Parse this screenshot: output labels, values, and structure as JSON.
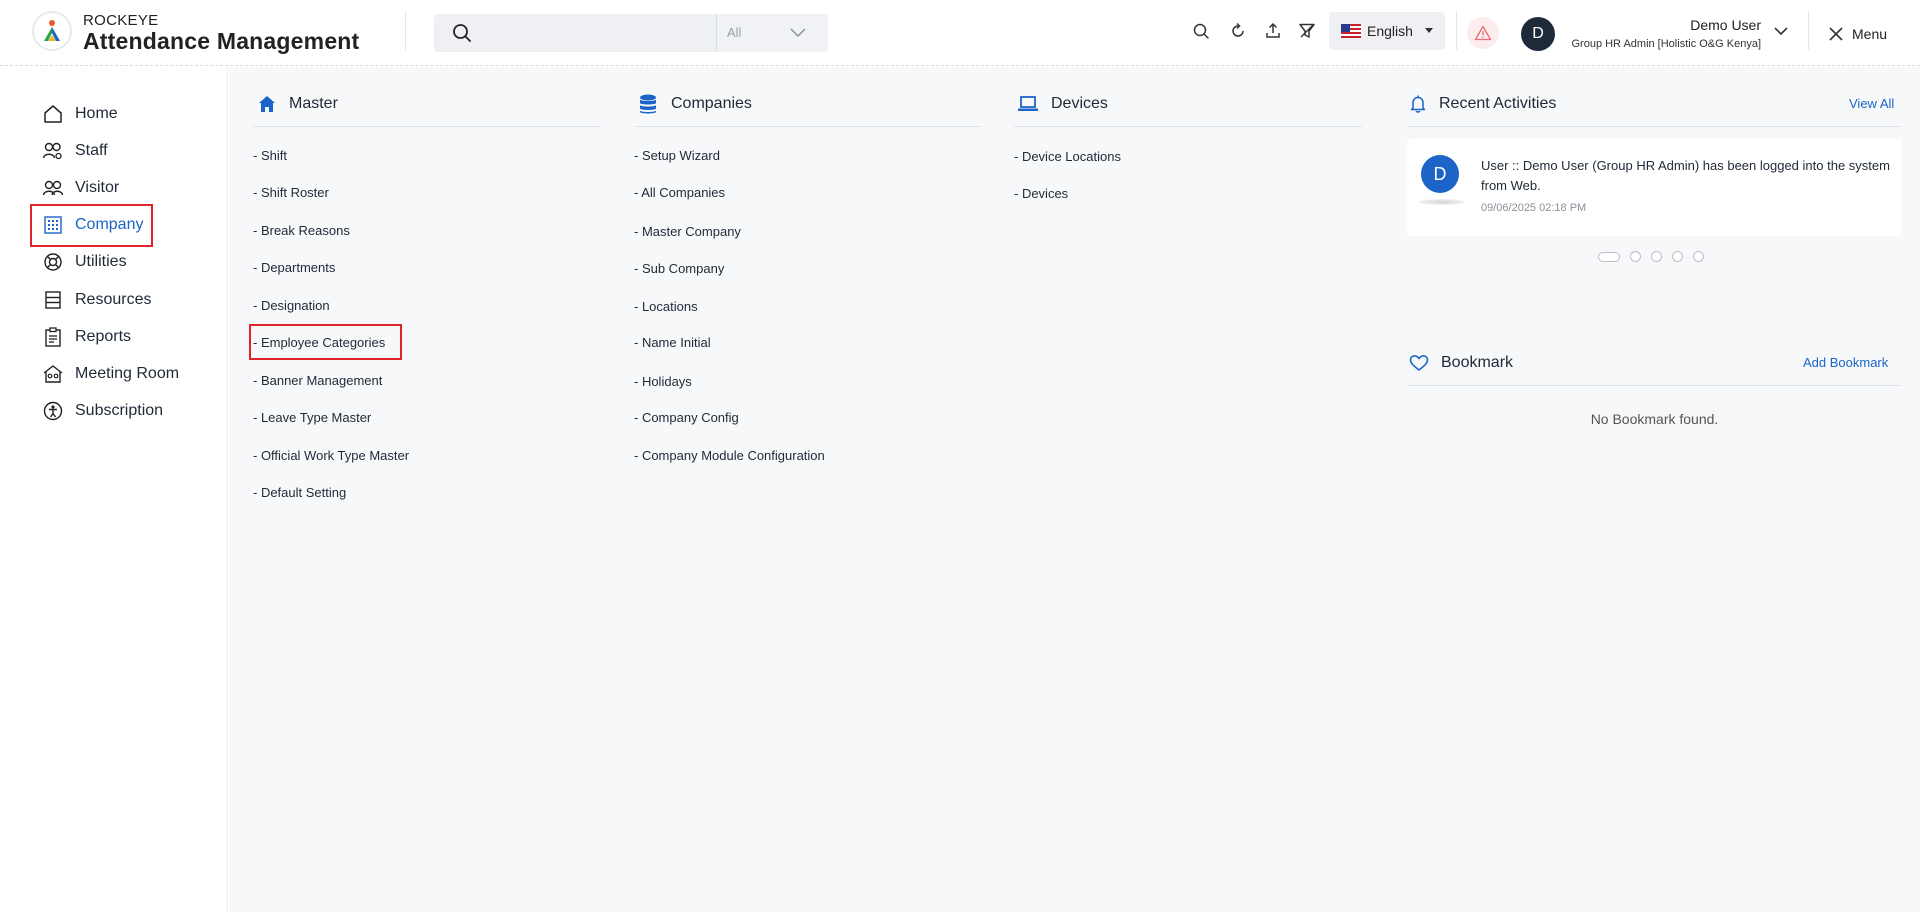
{
  "app": {
    "brand_top": "ROCKEYE",
    "brand_main": "Attendance Management"
  },
  "search": {
    "value": "",
    "placeholder": "",
    "scope": "All"
  },
  "language": {
    "label": "English",
    "flag": "us-flag"
  },
  "user": {
    "avatar_initial": "D",
    "name": "Demo User",
    "role": "Group HR Admin [Holistic O&G Kenya]"
  },
  "menu_label": "Menu",
  "sidebar": {
    "items": [
      {
        "label": "Home",
        "icon": "home-icon"
      },
      {
        "label": "Staff",
        "icon": "staff-icon"
      },
      {
        "label": "Visitor",
        "icon": "visitor-icon"
      },
      {
        "label": "Company",
        "icon": "company-icon",
        "active": true
      },
      {
        "label": "Utilities",
        "icon": "utilities-icon"
      },
      {
        "label": "Resources",
        "icon": "resources-icon"
      },
      {
        "label": "Reports",
        "icon": "reports-icon"
      },
      {
        "label": "Meeting Room",
        "icon": "meeting-room-icon"
      },
      {
        "label": "Subscription",
        "icon": "subscription-icon"
      }
    ]
  },
  "sections": {
    "master": {
      "title": "Master",
      "links": [
        "- Shift",
        "- Shift Roster",
        "- Break Reasons",
        "- Departments",
        "- Designation",
        "- Employee Categories",
        "- Banner Management",
        "- Leave Type Master",
        "- Official Work Type Master",
        "- Default Setting"
      ]
    },
    "companies": {
      "title": "Companies",
      "links": [
        "- Setup Wizard",
        "- All Companies",
        "- Master Company",
        "- Sub Company",
        "- Locations",
        "- Name Initial",
        "- Holidays",
        "- Company Config",
        "- Company Module Configuration"
      ]
    },
    "devices": {
      "title": "Devices",
      "links": [
        "- Device Locations",
        "- Devices"
      ]
    }
  },
  "recent_activities": {
    "title": "Recent Activities",
    "view_all": "View All",
    "item": {
      "avatar_initial": "D",
      "text": "User :: Demo User (Group HR Admin) has been logged into the system from Web.",
      "time": "09/06/2025 02:18 PM"
    },
    "pager": {
      "count": 5,
      "active": 1
    }
  },
  "bookmark": {
    "title": "Bookmark",
    "add_label": "Add Bookmark",
    "empty_message": "No Bookmark found."
  },
  "colors": {
    "accent": "#1c64c8",
    "highlight": "#e0242c",
    "main_bg": "#f7f8fa"
  }
}
